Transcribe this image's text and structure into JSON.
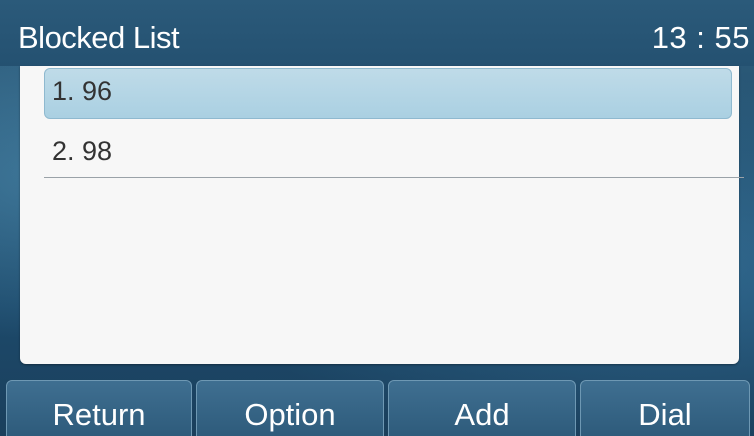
{
  "header": {
    "title": "Blocked List",
    "time": "13 : 55"
  },
  "list": {
    "items": [
      {
        "label": "1. 96",
        "selected": true
      },
      {
        "label": "2. 98",
        "selected": false
      }
    ]
  },
  "softkeys": {
    "return_label": "Return",
    "option_label": "Option",
    "add_label": "Add",
    "dial_label": "Dial"
  },
  "colors": {
    "header_bg": "#245171",
    "selection": "#aad0e2",
    "panel": "#f7f7f7",
    "softkey_bg": "#2d5a7a"
  }
}
